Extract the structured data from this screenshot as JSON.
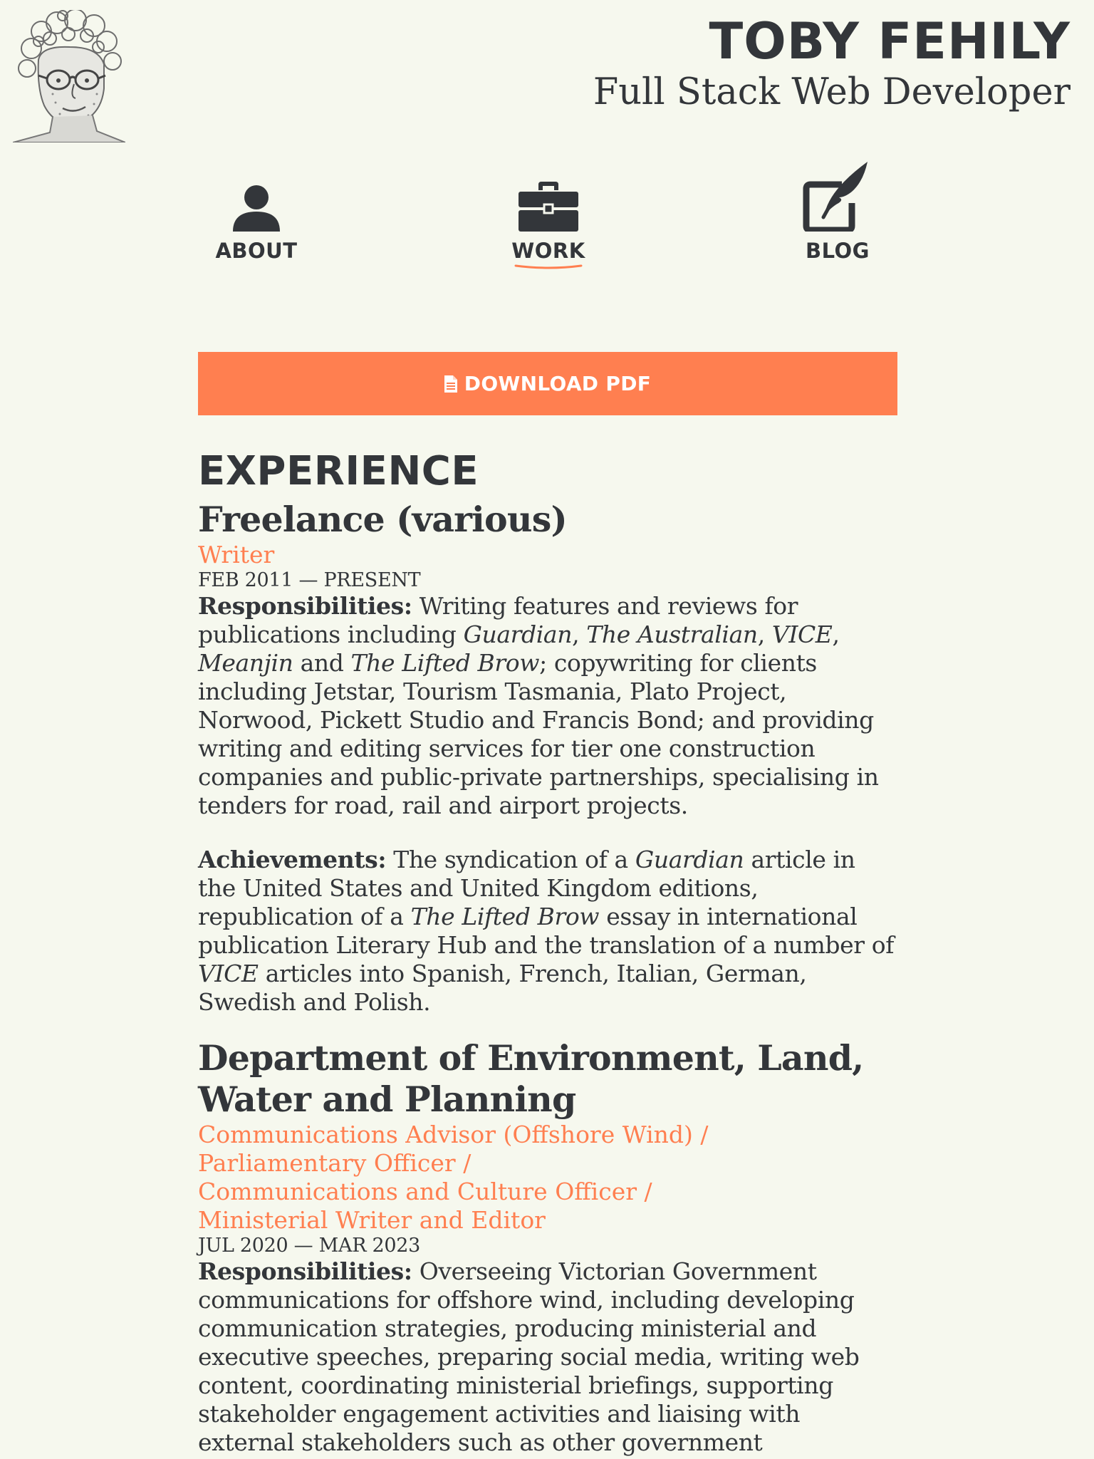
{
  "header": {
    "name": "TOBY FEHILY",
    "tagline": "Full Stack Web Developer"
  },
  "nav": [
    {
      "label": "ABOUT",
      "icon": "user-icon",
      "active": false
    },
    {
      "label": "WORK",
      "icon": "briefcase-icon",
      "active": true
    },
    {
      "label": "BLOG",
      "icon": "edit-quill-icon",
      "active": false
    }
  ],
  "download": {
    "label": "DOWNLOAD PDF",
    "icon": "document-icon"
  },
  "colors": {
    "accent": "#ff7f50",
    "text": "#33363a",
    "background": "#f6f8ee"
  },
  "experience": {
    "title": "EXPERIENCE",
    "jobs": [
      {
        "org": "Freelance (various)",
        "roles": [
          "Writer"
        ],
        "dates": "FEB 2011 — PRESENT",
        "responsibilities_label": "Responsibilities:",
        "responsibilities": [
          {
            "t": "Writing features and reviews for publications including ",
            "i": false
          },
          {
            "t": "Guardian",
            "i": true
          },
          {
            "t": ", ",
            "i": false
          },
          {
            "t": "The Australian",
            "i": true
          },
          {
            "t": ", ",
            "i": false
          },
          {
            "t": "VICE",
            "i": true
          },
          {
            "t": ", ",
            "i": false
          },
          {
            "t": "Meanjin",
            "i": true
          },
          {
            "t": " and ",
            "i": false
          },
          {
            "t": "The Lifted Brow",
            "i": true
          },
          {
            "t": "; copywriting for clients including Jetstar, Tourism Tasmania, Plato Project, Norwood, Pickett Studio and Francis Bond; and providing writing and editing services for tier one construction companies and public-private partnerships, specialising in tenders for road, rail and airport projects.",
            "i": false
          }
        ],
        "achievements_label": "Achievements:",
        "achievements": [
          {
            "t": "The syndication of a ",
            "i": false
          },
          {
            "t": "Guardian",
            "i": true
          },
          {
            "t": " article in the United States and United Kingdom editions, republication of a ",
            "i": false
          },
          {
            "t": "The Lifted Brow",
            "i": true
          },
          {
            "t": " essay in international publication Literary Hub and the translation of a number of ",
            "i": false
          },
          {
            "t": "VICE",
            "i": true
          },
          {
            "t": " articles into Spanish, French, Italian, German, Swedish and Polish.",
            "i": false
          }
        ]
      },
      {
        "org": "Department of Environment, Land, Water and Planning",
        "roles": [
          "Communications Advisor (Offshore Wind) /",
          "Parliamentary Officer /",
          "Communications and Culture Officer /",
          "Ministerial Writer and Editor"
        ],
        "dates": "JUL 2020 — MAR 2023",
        "responsibilities_label": "Responsibilities:",
        "responsibilities": [
          {
            "t": "Overseeing Victorian Government communications for offshore wind, including developing communication strategies, producing ministerial and executive speeches, preparing social media, writing web content, coordinating ministerial briefings, supporting stakeholder engagement activities and liaising with external stakeholders such as other government departments and",
            "i": false
          }
        ]
      }
    ]
  }
}
